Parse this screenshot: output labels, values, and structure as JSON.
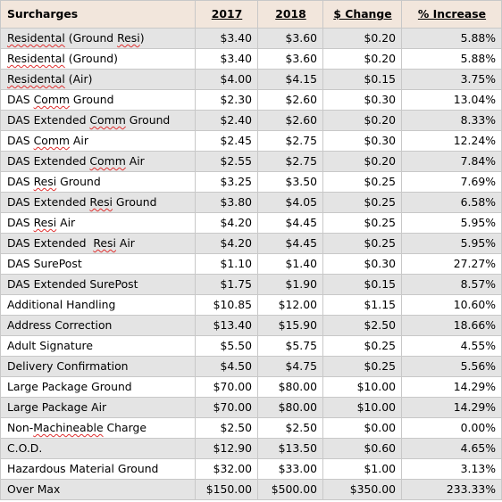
{
  "table": {
    "headers": {
      "name": "Surcharges",
      "y2017": "2017",
      "y2018": "2018",
      "change": "$ Change",
      "increase": "% Increase"
    },
    "rows": [
      {
        "name_parts": [
          {
            "t": "Residental",
            "spell": true
          },
          {
            "t": " (Ground "
          },
          {
            "t": "Resi",
            "spell": true
          },
          {
            "t": ")"
          }
        ],
        "y2017": "$3.40",
        "y2018": "$3.60",
        "change": "$0.20",
        "increase": "5.88%"
      },
      {
        "name_parts": [
          {
            "t": "Residental",
            "spell": true
          },
          {
            "t": " (Ground)"
          }
        ],
        "y2017": "$3.40",
        "y2018": "$3.60",
        "change": "$0.20",
        "increase": "5.88%"
      },
      {
        "name_parts": [
          {
            "t": "Residental",
            "spell": true
          },
          {
            "t": " (Air)"
          }
        ],
        "y2017": "$4.00",
        "y2018": "$4.15",
        "change": "$0.15",
        "increase": "3.75%"
      },
      {
        "name_parts": [
          {
            "t": "DAS "
          },
          {
            "t": "Comm",
            "spell": true
          },
          {
            "t": " Ground"
          }
        ],
        "y2017": "$2.30",
        "y2018": "$2.60",
        "change": "$0.30",
        "increase": "13.04%"
      },
      {
        "name_parts": [
          {
            "t": "DAS Extended "
          },
          {
            "t": "Comm",
            "spell": true
          },
          {
            "t": " Ground"
          }
        ],
        "y2017": "$2.40",
        "y2018": "$2.60",
        "change": "$0.20",
        "increase": "8.33%"
      },
      {
        "name_parts": [
          {
            "t": "DAS "
          },
          {
            "t": "Comm",
            "spell": true
          },
          {
            "t": " Air"
          }
        ],
        "y2017": "$2.45",
        "y2018": "$2.75",
        "change": "$0.30",
        "increase": "12.24%"
      },
      {
        "name_parts": [
          {
            "t": "DAS Extended "
          },
          {
            "t": "Comm",
            "spell": true
          },
          {
            "t": " Air"
          }
        ],
        "y2017": "$2.55",
        "y2018": "$2.75",
        "change": "$0.20",
        "increase": "7.84%"
      },
      {
        "name_parts": [
          {
            "t": "DAS "
          },
          {
            "t": "Resi",
            "spell": true
          },
          {
            "t": " Ground"
          }
        ],
        "y2017": "$3.25",
        "y2018": "$3.50",
        "change": "$0.25",
        "increase": "7.69%"
      },
      {
        "name_parts": [
          {
            "t": "DAS Extended "
          },
          {
            "t": "Resi",
            "spell": true
          },
          {
            "t": " Ground"
          }
        ],
        "y2017": "$3.80",
        "y2018": "$4.05",
        "change": "$0.25",
        "increase": "6.58%"
      },
      {
        "name_parts": [
          {
            "t": "DAS "
          },
          {
            "t": "Resi",
            "spell": true
          },
          {
            "t": " Air"
          }
        ],
        "y2017": "$4.20",
        "y2018": "$4.45",
        "change": "$0.25",
        "increase": "5.95%"
      },
      {
        "name_parts": [
          {
            "t": "DAS Extended  "
          },
          {
            "t": "Resi",
            "spell": true
          },
          {
            "t": " Air"
          }
        ],
        "y2017": "$4.20",
        "y2018": "$4.45",
        "change": "$0.25",
        "increase": "5.95%"
      },
      {
        "name_parts": [
          {
            "t": "DAS SurePost"
          }
        ],
        "y2017": "$1.10",
        "y2018": "$1.40",
        "change": "$0.30",
        "increase": "27.27%"
      },
      {
        "name_parts": [
          {
            "t": "DAS Extended SurePost"
          }
        ],
        "y2017": "$1.75",
        "y2018": "$1.90",
        "change": "$0.15",
        "increase": "8.57%"
      },
      {
        "name_parts": [
          {
            "t": "Additional Handling"
          }
        ],
        "y2017": "$10.85",
        "y2018": "$12.00",
        "change": "$1.15",
        "increase": "10.60%"
      },
      {
        "name_parts": [
          {
            "t": "Address Correction"
          }
        ],
        "y2017": "$13.40",
        "y2018": "$15.90",
        "change": "$2.50",
        "increase": "18.66%"
      },
      {
        "name_parts": [
          {
            "t": "Adult Signature"
          }
        ],
        "y2017": "$5.50",
        "y2018": "$5.75",
        "change": "$0.25",
        "increase": "4.55%"
      },
      {
        "name_parts": [
          {
            "t": "Delivery Confirmation"
          }
        ],
        "y2017": "$4.50",
        "y2018": "$4.75",
        "change": "$0.25",
        "increase": "5.56%"
      },
      {
        "name_parts": [
          {
            "t": "Large Package Ground"
          }
        ],
        "y2017": "$70.00",
        "y2018": "$80.00",
        "change": "$10.00",
        "increase": "14.29%"
      },
      {
        "name_parts": [
          {
            "t": "Large Package Air"
          }
        ],
        "y2017": "$70.00",
        "y2018": "$80.00",
        "change": "$10.00",
        "increase": "14.29%"
      },
      {
        "name_parts": [
          {
            "t": "Non-"
          },
          {
            "t": "Machineable",
            "spell": true
          },
          {
            "t": " Charge"
          }
        ],
        "y2017": "$2.50",
        "y2018": "$2.50",
        "change": "$0.00",
        "increase": "0.00%"
      },
      {
        "name_parts": [
          {
            "t": "C.O.D."
          }
        ],
        "y2017": "$12.90",
        "y2018": "$13.50",
        "change": "$0.60",
        "increase": "4.65%"
      },
      {
        "name_parts": [
          {
            "t": "Hazardous Material Ground"
          }
        ],
        "y2017": "$32.00",
        "y2018": "$33.00",
        "change": "$1.00",
        "increase": "3.13%"
      },
      {
        "name_parts": [
          {
            "t": "Over Max"
          }
        ],
        "y2017": "$150.00",
        "y2018": "$500.00",
        "change": "$350.00",
        "increase": "233.33%"
      }
    ]
  },
  "colors": {
    "header_bg": "#f2e6dc",
    "stripe_bg": "#e4e4e4",
    "spellcheck": "#e03030"
  }
}
